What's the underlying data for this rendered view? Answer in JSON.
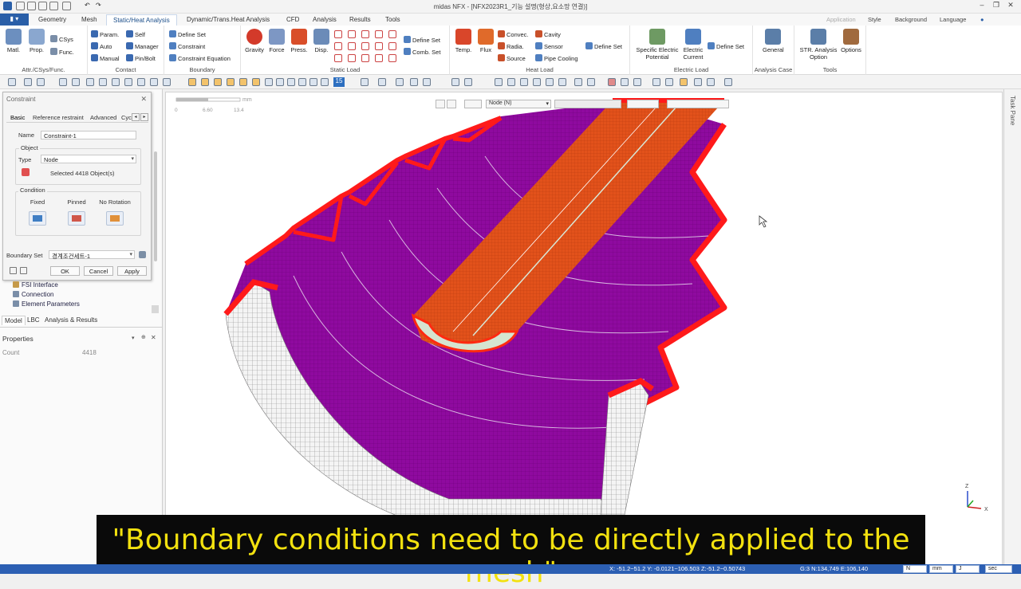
{
  "window": {
    "title": "midas NFX - [NFX2023R1_기능 설명(형상,요소망 연결)]",
    "right_menu": [
      "Application",
      "Style",
      "Background",
      "Language"
    ]
  },
  "tabs": [
    {
      "label": "Geometry"
    },
    {
      "label": "Mesh"
    },
    {
      "label": "Static/Heat Analysis",
      "active": true
    },
    {
      "label": "Dynamic/Trans.Heat Analysis"
    },
    {
      "label": "CFD"
    },
    {
      "label": "Analysis"
    },
    {
      "label": "Results"
    },
    {
      "label": "Tools"
    }
  ],
  "ribbon": {
    "attr": {
      "name": "Attr./CSys/Func.",
      "matl": "Matl.",
      "prop": "Prop.",
      "csys": "CSys",
      "func": "Func."
    },
    "contact": {
      "name": "Contact",
      "param": "Param.",
      "auto": "Auto",
      "manual": "Manual",
      "self": "Self",
      "manager": "Manager",
      "pinbolt": "Pin/Bolt"
    },
    "boundary": {
      "name": "Boundary",
      "define_set": "Define Set",
      "constraint": "Constraint",
      "constraint_eq": "Constraint Equation"
    },
    "static_load": {
      "name": "Static Load",
      "gravity": "Gravity",
      "force": "Force",
      "press": "Press.",
      "disp": "Disp.",
      "define_set": "Define Set",
      "comb_set": "Comb. Set"
    },
    "heat_load": {
      "name": "Heat Load",
      "temp": "Temp.",
      "flux": "Flux",
      "convec": "Convec.",
      "radia": "Radia.",
      "source": "Source",
      "cavity": "Cavity",
      "sensor": "Sensor",
      "pipe": "Pipe Cooling",
      "define_set": "Define Set"
    },
    "electric": {
      "name": "Electric Load",
      "sep": "Specific Electric",
      "sep2": "Potential",
      "ec": "Electric",
      "ec2": "Current",
      "define_set": "Define Set"
    },
    "analysis_case": {
      "name": "Analysis Case",
      "general": "General"
    },
    "tools": {
      "name": "Tools",
      "str": "STR. Analysis",
      "str2": "Option",
      "options": "Options"
    }
  },
  "toolbar": {
    "number": "15"
  },
  "dialog": {
    "title": "Constraint",
    "tabs": [
      "Basic",
      "Reference restraint",
      "Advanced",
      "Cyc"
    ],
    "name_label": "Name",
    "name_value": "Constraint-1",
    "object_label": "Object",
    "type_label": "Type",
    "type_value": "Node",
    "selected": "Selected 4418 Object(s)",
    "condition_label": "Condition",
    "conditions": [
      "Fixed",
      "Pinned",
      "No Rotation"
    ],
    "boundary_set_label": "Boundary Set",
    "boundary_set_value": "경계조건세트-1",
    "ok": "OK",
    "cancel": "Cancel",
    "apply": "Apply"
  },
  "tree": [
    "FSI Interface",
    "Connection",
    "Element Parameters"
  ],
  "panel_tabs": [
    "Model",
    "LBC",
    "Analysis & Results"
  ],
  "properties": {
    "title": "Properties",
    "key": "Count",
    "value": "4418"
  },
  "viewport": {
    "select_mode": "Node (N)",
    "scale_unit": "mm",
    "scale_ticks": [
      "0",
      "6.60",
      "13.4"
    ],
    "axis_labels": [
      "Z",
      "X"
    ],
    "task_pane": "Task Pane"
  },
  "subtitle": "\"Boundary conditions need to be directly applied to the mesh\"",
  "statusbar": {
    "coords": "X: -51.2~51.2 Y: -0.0121~106.503 Z:-51.2~0.50743",
    "count": "G:3  N:134,749  E:106,140",
    "units": [
      "N",
      "mm",
      "J",
      "sec"
    ]
  },
  "colors": {
    "accent": "#2c5fb3",
    "mesh_purple": "#8e0a9c",
    "mesh_red": "#ff1a1a",
    "shaft_orange": "#e0531a",
    "subtitle": "#f2e10f"
  }
}
